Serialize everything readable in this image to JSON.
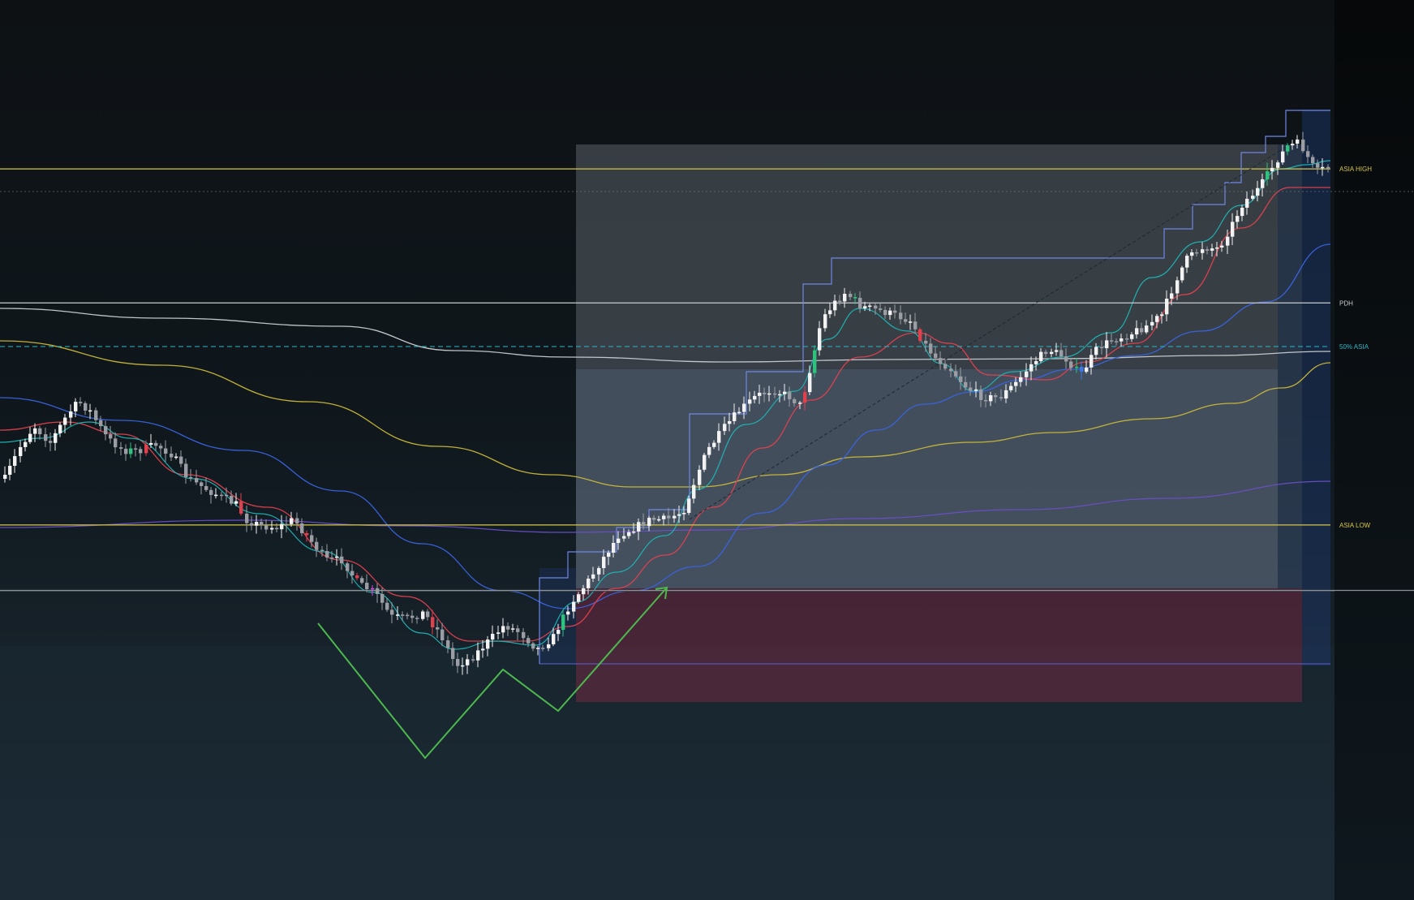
{
  "chart_data": {
    "type": "candlestick",
    "title": "",
    "xlabel": "",
    "ylabel": "",
    "grid": false,
    "ylim": [
      0,
      100
    ],
    "levels": [
      {
        "name": "asia-high",
        "label": "ASIA HIGH",
        "value": 80.4,
        "color": "#d6c64a",
        "style": "solid"
      },
      {
        "name": "pdh",
        "label": "PDH",
        "value": 63.2,
        "color": "#c8ccd2",
        "style": "solid"
      },
      {
        "name": "asia-50",
        "label": "50% ASIA",
        "value": 57.6,
        "color": "#2fb6c6",
        "style": "dashed"
      },
      {
        "name": "asia-low",
        "label": "ASIA LOW",
        "value": 34.7,
        "color": "#d6c64a",
        "style": "solid"
      },
      {
        "name": "current-price",
        "label": "",
        "value": 77.5,
        "color": "#6b7078",
        "style": "dotted"
      },
      {
        "name": "session-line",
        "label": "",
        "value": 26.3,
        "color": "#8b8f96",
        "style": "solid"
      }
    ],
    "colors": {
      "background_top": "#0d1114",
      "background_bottom": "#1c2b36",
      "axis_panel": "#050809",
      "candle_up": "#f2f2f2",
      "candle_down": "#9a9ea4",
      "candle_green": "#2ec27e",
      "candle_red": "#e0414f",
      "candle_blue": "#3a78e0",
      "candle_magenta": "#d34de0",
      "range_box": "#5a6068",
      "range_box_lower": "#5a6a88",
      "fvg_box": "#7a2a44",
      "trail_box": "#4f6fd6",
      "ema_fast": "#1fb5b5",
      "ema_mid": "#e0414f",
      "ema_slow": "#3a64e0",
      "sma_yellow": "#c9b83a",
      "sma_purple": "#6a4fc8",
      "sma_white": "#c9cdd2",
      "pattern": "#4db84d"
    }
  }
}
